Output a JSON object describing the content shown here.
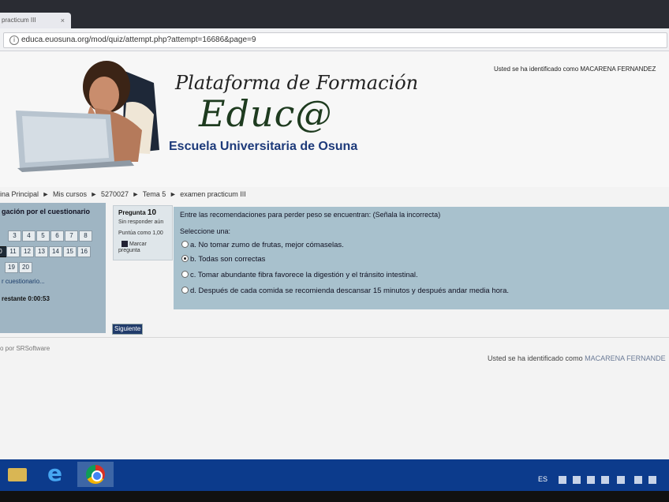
{
  "browser": {
    "tab_title": "practicum III",
    "tab_close": "×",
    "url": "educa.euosuna.org/mod/quiz/attempt.php?attempt=16686&page=9"
  },
  "header": {
    "logo_line1": "Plataforma de Formación",
    "logo_line2": "Educ@",
    "logo_line3": "Escuela Universitaria de Osuna",
    "login_text": "Usted se ha identificado como MACARENA FERNANDEZ"
  },
  "breadcrumb": {
    "items": [
      "ina Principal",
      "Mis cursos",
      "5270027",
      "Tema 5",
      "examen practicum III"
    ],
    "separator": "►"
  },
  "nav": {
    "title": "gación por el cuestionario",
    "buttons": [
      "3",
      "4",
      "5",
      "6",
      "7",
      "8",
      "0",
      "11",
      "12",
      "13",
      "14",
      "15",
      "16",
      "19",
      "20"
    ],
    "current": "0",
    "finish_link": "r cuestionario...",
    "timer": "restante 0:00:53"
  },
  "question_info": {
    "label": "Pregunta",
    "number": "10",
    "state": "Sin responder aún",
    "score": "Puntúa como 1,00",
    "flag_label": "Marcar pregunta"
  },
  "question": {
    "text": "Entre las recomendaciones para perder peso se encuentran: (Señala la incorrecta)",
    "prompt": "Seleccione una:",
    "options": [
      {
        "label": "a. No tomar zumo de frutas, mejor cómaselas.",
        "checked": false
      },
      {
        "label": "b. Todas son correctas",
        "checked": true
      },
      {
        "label": "c. Tomar abundante fibra favorece la digestión y el tránsito intestinal.",
        "checked": false
      },
      {
        "label": "d. Después de cada comida se recomienda descansar 15 minutos y después andar media hora.",
        "checked": false
      }
    ]
  },
  "next_button": "Siguiente",
  "footer": {
    "powered": "o por SRSoftware",
    "login_prefix": "Usted se ha identificado como",
    "login_name": "MACARENA FERNANDE"
  },
  "taskbar": {
    "language": "ES"
  }
}
